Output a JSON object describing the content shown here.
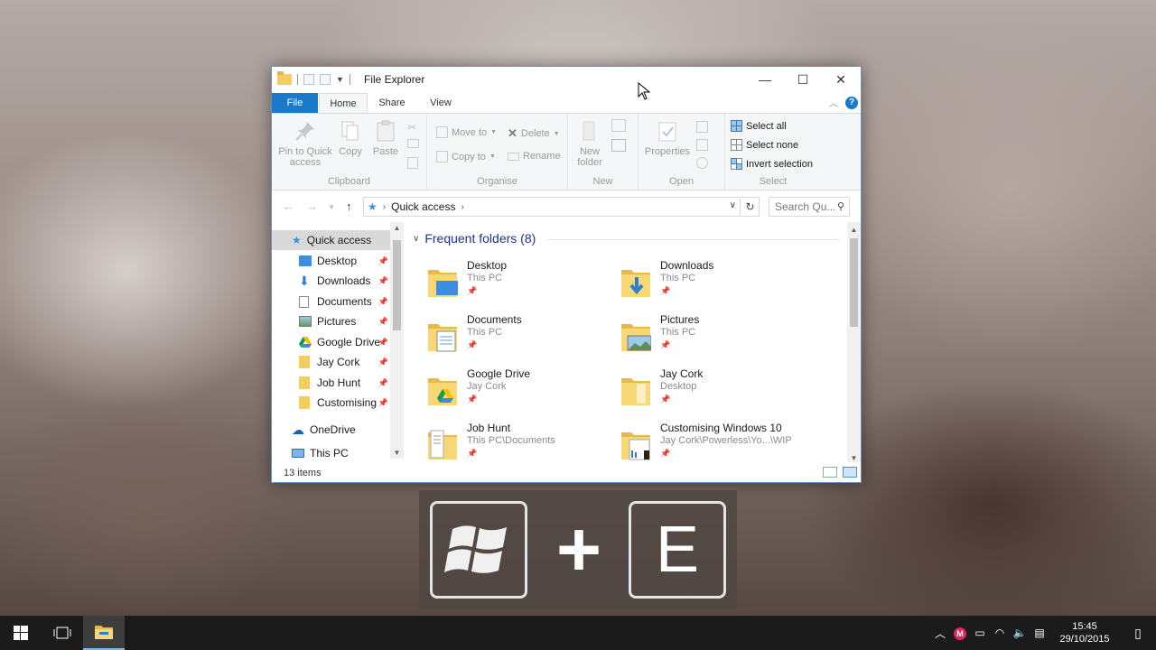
{
  "window": {
    "title": "File Explorer",
    "controls": {
      "minimize": "—",
      "maximize": "☐",
      "close": "✕"
    }
  },
  "tabs": {
    "file": "File",
    "home": "Home",
    "share": "Share",
    "view": "View"
  },
  "ribbon": {
    "clipboard": {
      "label": "Clipboard",
      "pin_line1": "Pin to Quick",
      "pin_line2": "access",
      "copy": "Copy",
      "paste": "Paste"
    },
    "organise": {
      "label": "Organise",
      "move_to": "Move to",
      "copy_to": "Copy to",
      "delete": "Delete",
      "rename": "Rename"
    },
    "new": {
      "label": "New",
      "new_folder_line1": "New",
      "new_folder_line2": "folder"
    },
    "open": {
      "label": "Open",
      "properties": "Properties"
    },
    "select": {
      "label": "Select",
      "select_all": "Select all",
      "select_none": "Select none",
      "invert_selection": "Invert selection"
    }
  },
  "address": {
    "location": "Quick access",
    "search_placeholder": "Search Qu..."
  },
  "nav_pane": {
    "items": [
      {
        "label": "Quick access",
        "icon": "star-icon",
        "pinned": false
      },
      {
        "label": "Desktop",
        "icon": "desktop-icon",
        "pinned": true
      },
      {
        "label": "Downloads",
        "icon": "download-icon",
        "pinned": true
      },
      {
        "label": "Documents",
        "icon": "document-icon",
        "pinned": true
      },
      {
        "label": "Pictures",
        "icon": "picture-icon",
        "pinned": true
      },
      {
        "label": "Google Drive",
        "icon": "google-drive-icon",
        "pinned": true
      },
      {
        "label": "Jay Cork",
        "icon": "folder-icon",
        "pinned": true
      },
      {
        "label": "Job Hunt",
        "icon": "folder-icon",
        "pinned": true
      },
      {
        "label": "Customising",
        "icon": "folder-icon",
        "pinned": true
      },
      {
        "label": "OneDrive",
        "icon": "onedrive-icon",
        "pinned": false
      },
      {
        "label": "This PC",
        "icon": "computer-icon",
        "pinned": false
      }
    ]
  },
  "content": {
    "section_title": "Frequent folders (8)",
    "folders": [
      {
        "name": "Desktop",
        "path": "This PC",
        "icon": "desktop-folder-icon"
      },
      {
        "name": "Downloads",
        "path": "This PC",
        "icon": "downloads-folder-icon"
      },
      {
        "name": "Documents",
        "path": "This PC",
        "icon": "documents-folder-icon"
      },
      {
        "name": "Pictures",
        "path": "This PC",
        "icon": "pictures-folder-icon"
      },
      {
        "name": "Google Drive",
        "path": "Jay Cork",
        "icon": "google-drive-folder-icon"
      },
      {
        "name": "Jay Cork",
        "path": "Desktop",
        "icon": "folder-icon"
      },
      {
        "name": "Job Hunt",
        "path": "This PC\\Documents",
        "icon": "folder-icon"
      },
      {
        "name": "Customising Windows 10",
        "path": "Jay Cork\\Powerless\\Yo...\\WIP",
        "icon": "folder-icon"
      }
    ]
  },
  "status": {
    "item_count": "13 items"
  },
  "shortcut_overlay": {
    "plus": "+",
    "key": "E"
  },
  "taskbar": {
    "time": "15:45",
    "date": "29/10/2015"
  },
  "colors": {
    "accent": "#1979ca",
    "folder": "#f5cd5b",
    "section_title": "#1e3287",
    "taskbar": "#1b1b1b"
  }
}
